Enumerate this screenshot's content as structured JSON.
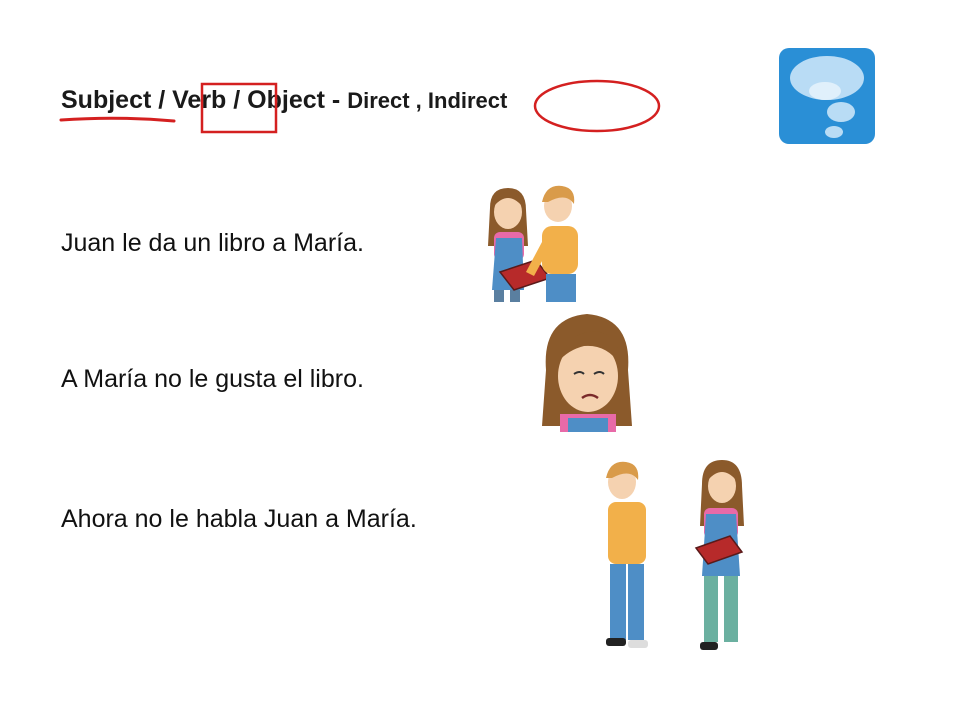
{
  "slide": {
    "heading": {
      "main": "Subject / Verb / Object - ",
      "direct": "Direct",
      "separator": " , ",
      "indirect": "Indirect"
    },
    "sentences": [
      "Juan le da un libro a María.",
      "A María no le gusta el libro.",
      "Ahora no le habla Juan a María."
    ],
    "icon": {
      "name": "speech-bubble-icon",
      "color": "#2a8fd6"
    },
    "annotation_color": "#d42020"
  }
}
